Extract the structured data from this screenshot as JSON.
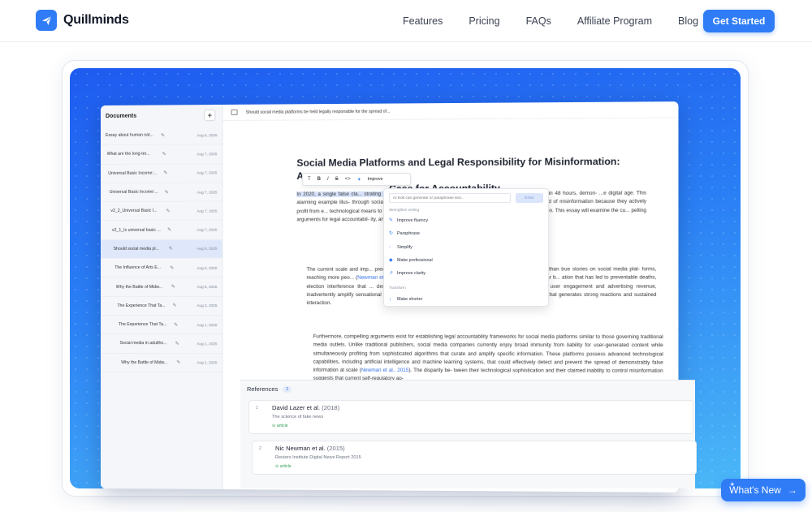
{
  "brand": {
    "name": "Quillminds",
    "logo_icon": "paper-plane-icon",
    "color": "#2f7cf6"
  },
  "nav": {
    "links": [
      "Features",
      "Pricing",
      "FAQs",
      "Affiliate Program",
      "Blog"
    ],
    "cta": "Get Started"
  },
  "app": {
    "sidebar": {
      "title": "Documents",
      "add": "+",
      "docs": [
        {
          "title": "Essay about human nat...",
          "date": "Aug 6, 2025"
        },
        {
          "title": "What are the long-ter...",
          "date": "Aug 7, 2025"
        },
        {
          "title": "Universal Basic Income:...",
          "date": "Aug 7, 2025"
        },
        {
          "title": "Universal Basic Income:...",
          "date": "Aug 7, 2025"
        },
        {
          "title": "v2_2_Universal Basic I...",
          "date": "Aug 7, 2025"
        },
        {
          "title": "v2_1_Is universal basic ...",
          "date": "Aug 7, 2025"
        },
        {
          "title": "Should social media pl...",
          "date": "Aug 6, 2025",
          "active": true
        },
        {
          "title": "The Influence of Arts E...",
          "date": "Aug 5, 2025"
        },
        {
          "title": "Why the Battle of Midw...",
          "date": "Aug 5, 2025"
        },
        {
          "title": "The Experience That Ta...",
          "date": "Aug 3, 2025"
        },
        {
          "title": "The Experience That Ta...",
          "date": "Aug 1, 2025"
        },
        {
          "title": "Social media in adultho...",
          "date": "Aug 1, 2025"
        },
        {
          "title": "Why the Battle of Midw...",
          "date": "Aug 1, 2025"
        }
      ]
    },
    "topbar_title": "Should social media platforms be held legally responsible for the spread of...",
    "doc_heading_line1": "Social Media Platforms and Legal Responsibility for Misinformation: A",
    "doc_heading_line2": "Case for Accountability",
    "p1": {
      "hl": "In 2020, a single false cla... strating the unprecedente... trates a critical challenge ...",
      "rest": "across Facebook within 48 hours, demon- ...e digital age. This alarming example illus- through social media platforms that prior- itize engagement over acc... for the spread of misinformation because they actively profit from e... technological means to prevent such spread, and their current ... harms caused by misinformation. This essay will examine the cu... pelling arguments for legal accountabil- ity, and suttest the counte..."
    },
    "p2": {
      "a": "The current scale and imp... precedented threat to public welfare and democratic institutions. Re... ter than true stories on social media plat- forms, reaching more peo...",
      "cite": "Newman et al., 2015",
      "b": ". The real-world consequences of this phenomenon extend far b... ation that has led to preventable deaths, election interference that ... destabilize communities. Platform algo- rithms, designed to maximize user engagement and advertising revenue, inadvertently amplify sensational and emotionally charged content, which often includes misinformation that generates strong reactions and sustained interaction."
    },
    "p3": {
      "a": "Furthermore, compelling arguments exist for establishing legal accountability frameworks for social media platforms similar to those governing traditional media outlets. Unlike traditional publishers, social media companies currently enjoy broad immunity from liability for user-generated content while simultaneously profiting from sophisticated algorithms that curate and amplify specific information. These platforms possess advanced technological capabilities, including artificial intelligence and machine learning systems, that could effectively detect and prevent the spread of demonstrably false information at scale",
      "cite": "Newman et al., 2015",
      "b": ". The disparity be- tween their technological sophistication and their claimed inability to control misinformation suggests that current self-regulatory ap-"
    },
    "toolbar": {
      "items": [
        "T",
        "B",
        "I",
        "S",
        "<>"
      ],
      "improve": "Improve"
    },
    "ai_menu": {
      "placeholder": "AI Edit can generate or paraphrase text...",
      "enter": "Enter",
      "section1": "Strengthen writing",
      "items1": [
        "Improve fluency",
        "Paraphrase",
        "Simplify",
        "Make professional",
        "Improve clarity"
      ],
      "section2": "Transform",
      "items2": [
        "Make shorter"
      ]
    },
    "references": {
      "title": "References",
      "count": "2",
      "items": [
        {
          "num": "1",
          "author": "David Lazer et al.",
          "year": "(2018)",
          "title": "The science of fake news",
          "type": "article"
        },
        {
          "num": "2",
          "author": "Nic Newman et al.",
          "year": "(2015)",
          "title": "Reuters Institute Digital News Report 2015",
          "type": "article"
        }
      ]
    }
  },
  "whats_new": "What's New"
}
